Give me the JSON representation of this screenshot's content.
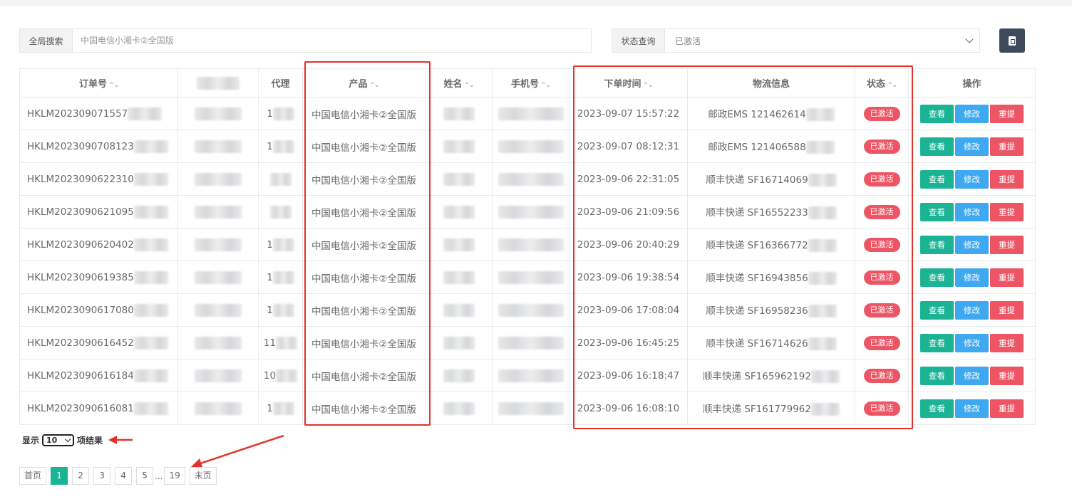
{
  "search": {
    "label": "全局搜索",
    "placeholder": "中国电信小湘卡②全国版"
  },
  "status_filter": {
    "label": "状态查询",
    "value": "已激活"
  },
  "table": {
    "headers": [
      "订单号",
      "",
      "代理",
      "产品",
      "姓名",
      "手机号",
      "下单时间",
      "物流信息",
      "状态",
      "操作"
    ],
    "rows": [
      {
        "order": "HKLM202309071557",
        "agent": "1",
        "product": "中国电信小湘卡②全国版",
        "time": "2023-09-07 15:57:22",
        "logistics": "邮政EMS 121462614",
        "status": "已激活"
      },
      {
        "order": "HKLM2023090708123",
        "agent": "1",
        "product": "中国电信小湘卡②全国版",
        "time": "2023-09-07 08:12:31",
        "logistics": "邮政EMS 121406588",
        "status": "已激活"
      },
      {
        "order": "HKLM2023090622310",
        "agent": "",
        "product": "中国电信小湘卡②全国版",
        "time": "2023-09-06 22:31:05",
        "logistics": "顺丰快递 SF16714069",
        "status": "已激活"
      },
      {
        "order": "HKLM2023090621095",
        "agent": "",
        "product": "中国电信小湘卡②全国版",
        "time": "2023-09-06 21:09:56",
        "logistics": "顺丰快递 SF16552233",
        "status": "已激活"
      },
      {
        "order": "HKLM2023090620402",
        "agent": "1",
        "product": "中国电信小湘卡②全国版",
        "time": "2023-09-06 20:40:29",
        "logistics": "顺丰快递 SF16366772",
        "status": "已激活"
      },
      {
        "order": "HKLM2023090619385",
        "agent": "1",
        "product": "中国电信小湘卡②全国版",
        "time": "2023-09-06 19:38:54",
        "logistics": "顺丰快递 SF16943856",
        "status": "已激活"
      },
      {
        "order": "HKLM2023090617080",
        "agent": "1",
        "product": "中国电信小湘卡②全国版",
        "time": "2023-09-06 17:08:04",
        "logistics": "顺丰快递 SF16958236",
        "status": "已激活"
      },
      {
        "order": "HKLM2023090616452",
        "agent": "11",
        "product": "中国电信小湘卡②全国版",
        "time": "2023-09-06 16:45:25",
        "logistics": "顺丰快递 SF16714626",
        "status": "已激活"
      },
      {
        "order": "HKLM2023090616184",
        "agent": "10",
        "product": "中国电信小湘卡②全国版",
        "time": "2023-09-06 16:18:47",
        "logistics": "顺丰快递 SF165962192",
        "status": "已激活"
      },
      {
        "order": "HKLM2023090616081",
        "agent": "1",
        "product": "中国电信小湘卡②全国版",
        "time": "2023-09-06 16:08:10",
        "logistics": "顺丰快递 SF161779962",
        "status": "已激活"
      }
    ],
    "actions": {
      "view": "查看",
      "edit": "修改",
      "resubmit": "重提"
    }
  },
  "page_size": {
    "prefix": "显示",
    "value": "10",
    "suffix": "项结果"
  },
  "pagination": {
    "first": "首页",
    "pages": [
      "1",
      "2",
      "3",
      "4",
      "5"
    ],
    "dots": "...",
    "last_page": "19",
    "last": "末页",
    "current": "1"
  },
  "colors": {
    "accent": "#1ab394",
    "edit": "#3ea8f0",
    "danger": "#ed5565",
    "annotation": "#e4322b"
  }
}
